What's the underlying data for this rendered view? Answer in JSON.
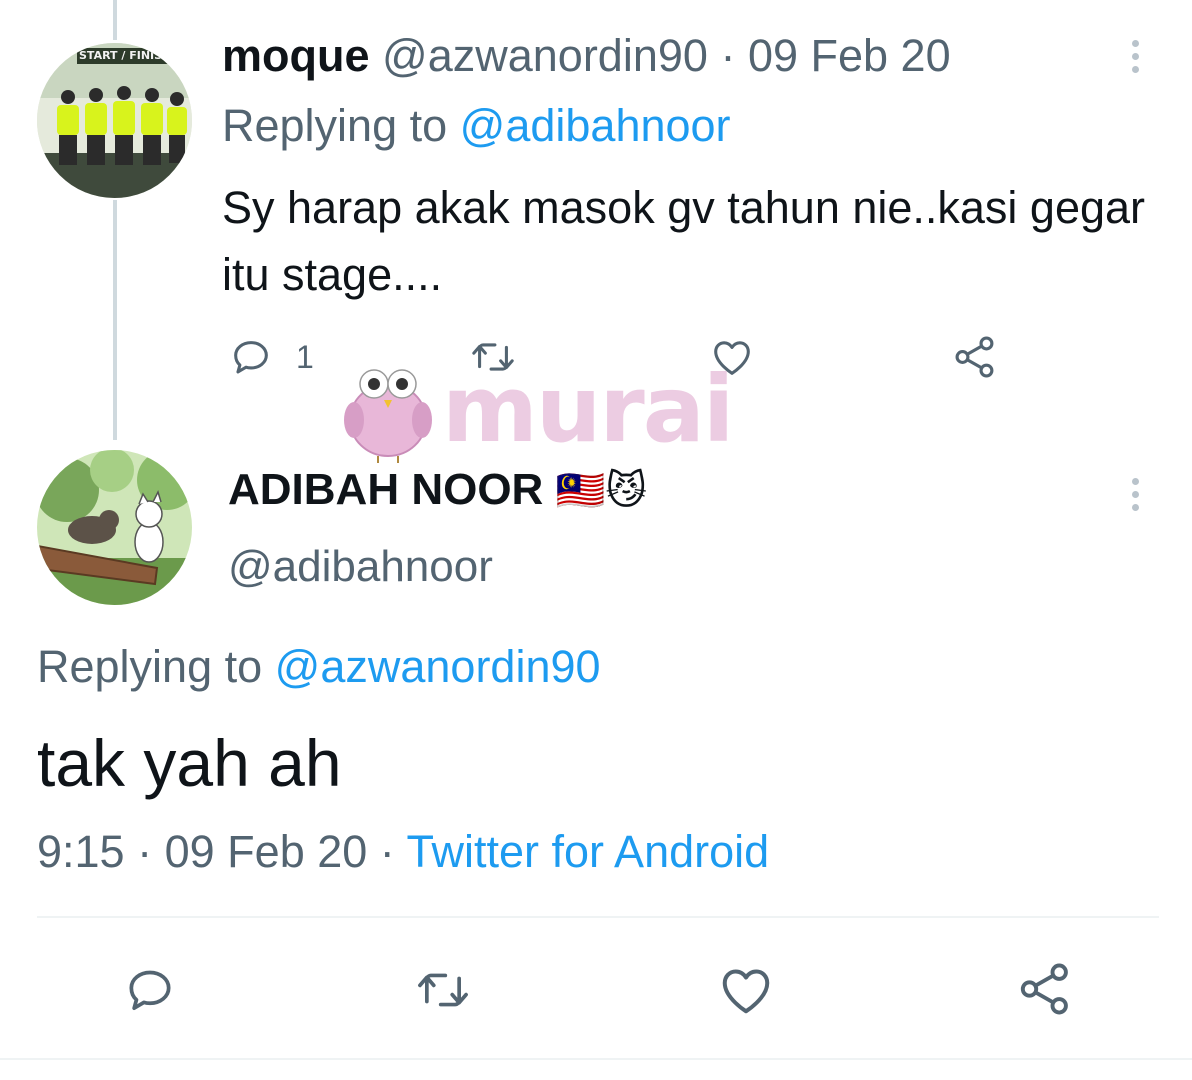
{
  "reply_tweet": {
    "display_name": "moque",
    "handle": "@azwanordin90",
    "separator": "·",
    "date": "09 Feb 20",
    "replying_label": "Replying to",
    "replying_handle": "@adibahnoor",
    "text": "Sy harap akak masok gv tahun nie..kasi gegar itu stage....",
    "reply_count": "1",
    "avatar_banner_text": "START / FINISH",
    "icons": [
      "reply-icon",
      "retweet-icon",
      "like-icon",
      "share-icon",
      "more-icon"
    ]
  },
  "watermark": {
    "text": "murai",
    "color": "#e9c4dd"
  },
  "main_tweet": {
    "display_name": "ADIBAH NOOR",
    "name_emojis": "🇲🇾😼",
    "handle": "@adibahnoor",
    "replying_label": "Replying to",
    "replying_handle": "@azwanordin90",
    "text": "tak yah ah",
    "time": "9:15",
    "separator": "·",
    "date": "09 Feb 20",
    "source": "Twitter for Android",
    "icons": [
      "reply-icon",
      "retweet-icon",
      "like-icon",
      "share-icon",
      "more-icon"
    ]
  },
  "colors": {
    "link": "#1d9bf0",
    "muted": "#536471",
    "text": "#0f1419",
    "thread_line": "#cfd9de"
  }
}
